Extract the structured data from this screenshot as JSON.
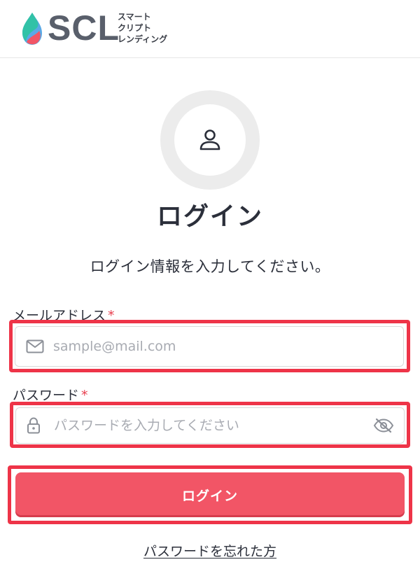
{
  "brand": {
    "name": "SCL",
    "tagline_lines": [
      "スマート",
      "クリプト",
      "レンディング"
    ]
  },
  "login": {
    "title": "ログイン",
    "description": "ログイン情報を入力してください。",
    "email_label": "メールアドレス",
    "email_placeholder": "sample@mail.com",
    "password_label": "パスワード",
    "password_placeholder": "パスワードを入力してください",
    "required_mark": "*",
    "submit_label": "ログイン",
    "forgot_link": "パスワードを忘れた方"
  },
  "colors": {
    "accent": "#f25566",
    "highlight": "#ee3448",
    "required": "#e8404f"
  },
  "icons": [
    "user-icon",
    "mail-icon",
    "lock-icon",
    "eye-off-icon"
  ]
}
